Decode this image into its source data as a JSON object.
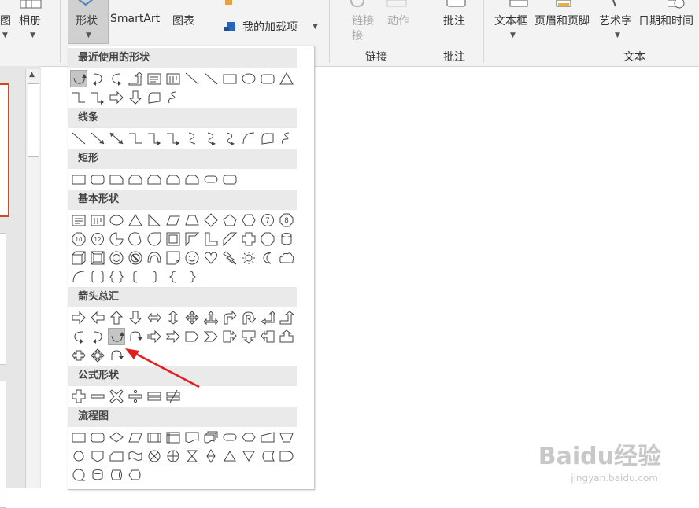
{
  "ribbon": {
    "album_label": "相册",
    "shapes_label": "形状",
    "smartart_label": "SmartArt",
    "chart_label": "图表",
    "addins_label": "我的加载项",
    "link_label": "链接",
    "link_label2": "接",
    "action_label": "动作",
    "comment_label": "批注",
    "textbox_label": "文本框",
    "header_footer_label": "页眉和页脚",
    "wordart_label": "艺术字",
    "datetime_label": "日期和时间",
    "truncated_left": "图",
    "group_links": "链接",
    "group_comments": "批注",
    "group_text": "文本"
  },
  "gallery": {
    "sections": [
      {
        "title": "最近使用的形状"
      },
      {
        "title": "线条"
      },
      {
        "title": "矩形"
      },
      {
        "title": "基本形状"
      },
      {
        "title": "箭头总汇"
      },
      {
        "title": "公式形状"
      },
      {
        "title": "流程图"
      }
    ],
    "selected_shape": "u-turn-arrow",
    "num_labels": [
      "7",
      "8",
      "10",
      "12"
    ]
  },
  "watermark": {
    "brand": "Baidu经验",
    "url": "jingyan.baidu.com"
  },
  "colors": {
    "arrow": "#e02020",
    "ribbon_bg": "#f3f3f3",
    "shape_stroke": "#444444",
    "slide_border": "#d24726"
  }
}
